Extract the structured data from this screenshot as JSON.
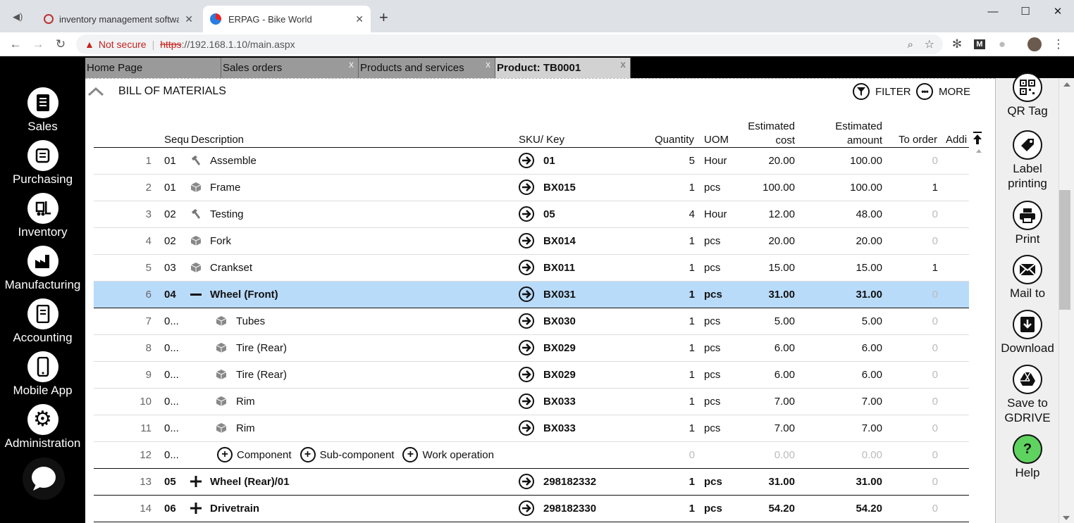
{
  "browser": {
    "tabs": [
      {
        "title": "inventory management software",
        "active": false
      },
      {
        "title": "ERPAG - Bike World",
        "active": true
      }
    ],
    "new_tab": "+",
    "security": "Not secure",
    "url_scheme": "https",
    "url_rest": "://192.168.1.10/main.aspx"
  },
  "sidebar": {
    "items": [
      {
        "label": "Sales"
      },
      {
        "label": "Purchasing"
      },
      {
        "label": "Inventory"
      },
      {
        "label": "Manufacturing"
      },
      {
        "label": "Accounting"
      },
      {
        "label": "Mobile App"
      },
      {
        "label": "Administration"
      }
    ]
  },
  "app_tabs": [
    {
      "label": "Home Page",
      "close": ""
    },
    {
      "label": "Sales orders",
      "close": "x"
    },
    {
      "label": "Products and services",
      "close": "x"
    },
    {
      "label": "Product: TB0001",
      "close": "x"
    }
  ],
  "section": {
    "title": "BILL OF MATERIALS",
    "filter": "FILTER",
    "more": "MORE"
  },
  "columns": {
    "seq": "Sequ",
    "description": "Description",
    "sku": "SKU/ Key",
    "quantity": "Quantity",
    "uom": "UOM",
    "est_cost_1": "Estimated",
    "est_cost_2": "cost",
    "est_amount_1": "Estimated",
    "est_amount_2": "amount",
    "to_order": "To order",
    "additional": "Addi"
  },
  "rows": [
    {
      "n": "1",
      "seq": "01",
      "icon": "hammer",
      "desc": "Assemble",
      "sku": "01",
      "qty": "5",
      "uom": "Hour",
      "cost": "20.00",
      "amount": "100.00",
      "order": "0"
    },
    {
      "n": "2",
      "seq": "01",
      "icon": "box",
      "desc": "Frame",
      "sku": "BX015",
      "qty": "1",
      "uom": "pcs",
      "cost": "100.00",
      "amount": "100.00",
      "order": "1"
    },
    {
      "n": "3",
      "seq": "02",
      "icon": "hammer",
      "desc": "Testing",
      "sku": "05",
      "qty": "4",
      "uom": "Hour",
      "cost": "12.00",
      "amount": "48.00",
      "order": "0"
    },
    {
      "n": "4",
      "seq": "02",
      "icon": "box",
      "desc": "Fork",
      "sku": "BX014",
      "qty": "1",
      "uom": "pcs",
      "cost": "20.00",
      "amount": "20.00",
      "order": "0"
    },
    {
      "n": "5",
      "seq": "03",
      "icon": "box",
      "desc": "Crankset",
      "sku": "BX011",
      "qty": "1",
      "uom": "pcs",
      "cost": "15.00",
      "amount": "15.00",
      "order": "1"
    },
    {
      "n": "6",
      "seq": "04",
      "icon": "minus",
      "desc": "Wheel (Front)",
      "sku": "BX031",
      "qty": "1",
      "uom": "pcs",
      "cost": "31.00",
      "amount": "31.00",
      "order": "0"
    },
    {
      "n": "7",
      "seq": "0...",
      "icon": "box",
      "desc": "Tubes",
      "sku": "BX030",
      "qty": "1",
      "uom": "pcs",
      "cost": "5.00",
      "amount": "5.00",
      "order": "0"
    },
    {
      "n": "8",
      "seq": "0...",
      "icon": "box",
      "desc": "Tire (Rear)",
      "sku": "BX029",
      "qty": "1",
      "uom": "pcs",
      "cost": "6.00",
      "amount": "6.00",
      "order": "0"
    },
    {
      "n": "9",
      "seq": "0...",
      "icon": "box",
      "desc": "Tire (Rear)",
      "sku": "BX029",
      "qty": "1",
      "uom": "pcs",
      "cost": "6.00",
      "amount": "6.00",
      "order": "0"
    },
    {
      "n": "10",
      "seq": "0...",
      "icon": "box",
      "desc": "Rim",
      "sku": "BX033",
      "qty": "1",
      "uom": "pcs",
      "cost": "7.00",
      "amount": "7.00",
      "order": "0"
    },
    {
      "n": "11",
      "seq": "0...",
      "icon": "box",
      "desc": "Rim",
      "sku": "BX033",
      "qty": "1",
      "uom": "pcs",
      "cost": "7.00",
      "amount": "7.00",
      "order": "0"
    }
  ],
  "add_row": {
    "n": "12",
    "seq": "0...",
    "component": "Component",
    "sub_component": "Sub-component",
    "work_operation": "Work operation",
    "qty": "0",
    "cost": "0.00",
    "amount": "0.00",
    "order": "0"
  },
  "bottom_rows": [
    {
      "n": "13",
      "seq": "05",
      "desc": "Wheel (Rear)/01",
      "sku": "298182332",
      "qty": "1",
      "uom": "pcs",
      "cost": "31.00",
      "amount": "31.00",
      "order": "0"
    },
    {
      "n": "14",
      "seq": "06",
      "desc": "Drivetrain",
      "sku": "298182330",
      "qty": "1",
      "uom": "pcs",
      "cost": "54.20",
      "amount": "54.20",
      "order": "0"
    }
  ],
  "right_panel": {
    "items": [
      {
        "label1": "QR Tag",
        "label2": ""
      },
      {
        "label1": "Label",
        "label2": "printing"
      },
      {
        "label1": "Print",
        "label2": ""
      },
      {
        "label1": "Mail to",
        "label2": ""
      },
      {
        "label1": "Download",
        "label2": ""
      },
      {
        "label1": "Save to",
        "label2": "GDRIVE"
      },
      {
        "label1": "Help",
        "label2": ""
      }
    ],
    "help_color": "#5fd35f"
  }
}
